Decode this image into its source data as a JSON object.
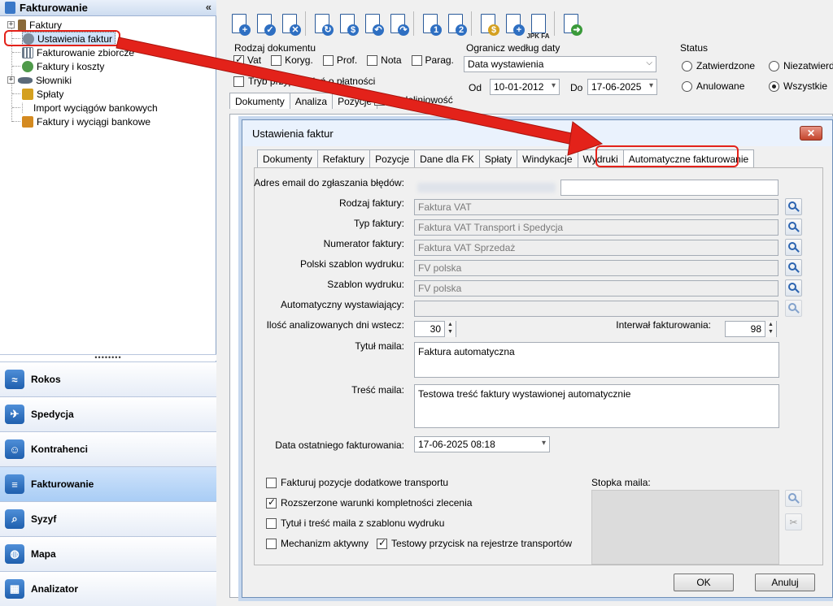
{
  "left": {
    "header_title": "Fakturowanie",
    "collapse_glyph": "«",
    "tree": [
      {
        "label": "Faktury",
        "expand": "+",
        "icon": "invoice-icon",
        "color": "#8a6a3a"
      },
      {
        "label": "Ustawienia faktur",
        "icon": "gear-icon",
        "color": "#7d8a9a"
      },
      {
        "label": "Fakturowanie zbiorcze",
        "icon": "grid-icon",
        "color": "#6c7a8a"
      },
      {
        "label": "Faktury i koszty",
        "icon": "coins-icon",
        "color": "#4f9a4a"
      },
      {
        "label": "Słowniki",
        "expand": "+",
        "icon": "book-icon",
        "color": "#5a6a7a"
      },
      {
        "label": "Spłaty",
        "icon": "money-icon",
        "color": "#d4a020"
      },
      {
        "label": "Import wyciągów bankowych",
        "icon": "import-icon",
        "color": "#999999"
      },
      {
        "label": "Faktury i wyciągi bankowe",
        "icon": "bank-icon",
        "color": "#d48a20"
      }
    ],
    "grip": "••••••••",
    "nav": [
      {
        "label": "Rokos",
        "icon": "rokos-icon",
        "glyph": "≈"
      },
      {
        "label": "Spedycja",
        "icon": "map-route-icon",
        "glyph": "✈"
      },
      {
        "label": "Kontrahenci",
        "icon": "contacts-icon",
        "glyph": "☺"
      },
      {
        "label": "Fakturowanie",
        "icon": "document-icon",
        "glyph": "≡"
      },
      {
        "label": "Syzyf",
        "icon": "magnifier-icon",
        "glyph": "⌕"
      },
      {
        "label": "Mapa",
        "icon": "globe-icon",
        "glyph": "◍"
      },
      {
        "label": "Analizator",
        "icon": "chart-icon",
        "glyph": "▦"
      }
    ]
  },
  "toolbar": {
    "buttons": [
      {
        "name": "add-document-button",
        "badge": "+",
        "color": "#2e6fc2"
      },
      {
        "name": "edit-document-button",
        "badge": "✓",
        "color": "#2e6fc2"
      },
      {
        "name": "delete-document-button",
        "badge": "✕",
        "color": "#2e6fc2"
      },
      {
        "name": "refresh-document-button",
        "badge": "↻",
        "color": "#2e6fc2"
      },
      {
        "name": "print-document-button",
        "badge": "$",
        "color": "#2e6fc2"
      },
      {
        "name": "undo-document-button",
        "badge": "↶",
        "color": "#2e6fc2"
      },
      {
        "name": "redo-document-button",
        "badge": "↷",
        "color": "#2e6fc2"
      },
      {
        "name": "folder-1-button",
        "badge": "1",
        "color": "#2e6fc2"
      },
      {
        "name": "folder-2-button",
        "badge": "2",
        "color": "#2e6fc2"
      },
      {
        "name": "coins-button",
        "badge": "$",
        "color": "#d4a020"
      },
      {
        "name": "settle-button",
        "badge": "+",
        "color": "#2e6fc2"
      },
      {
        "name": "jpk-fa-button",
        "badge": "",
        "color": "#2e6fc2"
      },
      {
        "name": "export-button",
        "badge": "➜",
        "color": "#3a9a3a"
      }
    ],
    "jpk_label": "JPK FA"
  },
  "filters": {
    "rodzaj_title": "Rodzaj dokumentu",
    "rodzaj": [
      {
        "label": "Vat",
        "checked": true
      },
      {
        "label": "Koryg.",
        "checked": false
      },
      {
        "label": "Prof.",
        "checked": false
      },
      {
        "label": "Nota",
        "checked": false
      },
      {
        "label": "Parag.",
        "checked": false
      }
    ],
    "tryb_label": "Tryb przypomnień o płatności",
    "ogranicz_title": "Ogranicz według daty",
    "date_type": "Data wystawienia",
    "od_label": "Od",
    "od_value": "10-01-2012",
    "do_label": "Do",
    "do_value": "17-06-2025",
    "status_title": "Status",
    "status": [
      {
        "label": "Zatwierdzone",
        "checked": false
      },
      {
        "label": "Niezatwierdz",
        "checked": false
      },
      {
        "label": "Anulowane",
        "checked": false
      },
      {
        "label": "Wszystkie",
        "checked": true
      }
    ],
    "tabs": [
      "Dokumenty",
      "Analiza",
      "Pozycje"
    ],
    "wielo_label": "Wieloliniowość"
  },
  "dialog": {
    "title": "Ustawienia faktur",
    "close_glyph": "✕",
    "tabs": [
      "Dokumenty",
      "Refaktury",
      "Pozycje",
      "Dane dla FK",
      "Spłaty",
      "Windykacje",
      "Wydruki",
      "Automatyczne fakturowanie"
    ],
    "email_label": "Adres email do zgłaszania błędów:",
    "email_value": "",
    "rodzaj_label": "Rodzaj faktury:",
    "rodzaj_value": "Faktura VAT",
    "typ_label": "Typ faktury:",
    "typ_value": "Faktura VAT Transport i Spedycja",
    "numerator_label": "Numerator faktury:",
    "numerator_value": "Faktura VAT Sprzedaż",
    "polski_label": "Polski szablon wydruku:",
    "polski_value": "FV polska",
    "szablon_label": "Szablon wydruku:",
    "szablon_value": "FV polska",
    "auto_label": "Automatyczny wystawiający:",
    "auto_value": "",
    "ilosc_label": "Ilość analizowanych dni wstecz:",
    "ilosc_value": "30",
    "interwal_label": "Interwał fakturowania:",
    "interwal_value": "98",
    "tytul_label": "Tytuł maila:",
    "tytul_value": "Faktura automatyczna",
    "tresc_label": "Treść maila:",
    "tresc_value": "Testowa treść faktury wystawionej automatycznie",
    "data_label": "Data ostatniego fakturowania:",
    "data_value": "17-06-2025 08:18",
    "checkboxes": [
      {
        "label": "Fakturuj pozycje dodatkowe transportu",
        "checked": false
      },
      {
        "label": "Rozszerzone warunki kompletności zlecenia",
        "checked": true
      },
      {
        "label": "Tytuł i treść maila z szablonu wydruku",
        "checked": false
      },
      {
        "label": "Mechanizm aktywny",
        "checked": false
      },
      {
        "label": "Testowy przycisk na rejestrze transportów",
        "checked": true
      }
    ],
    "stopka_label": "Stopka maila:",
    "ok_label": "OK",
    "cancel_label": "Anuluj"
  },
  "colors": {
    "highlight": "#e3221a",
    "accent": "#2b63b0"
  }
}
